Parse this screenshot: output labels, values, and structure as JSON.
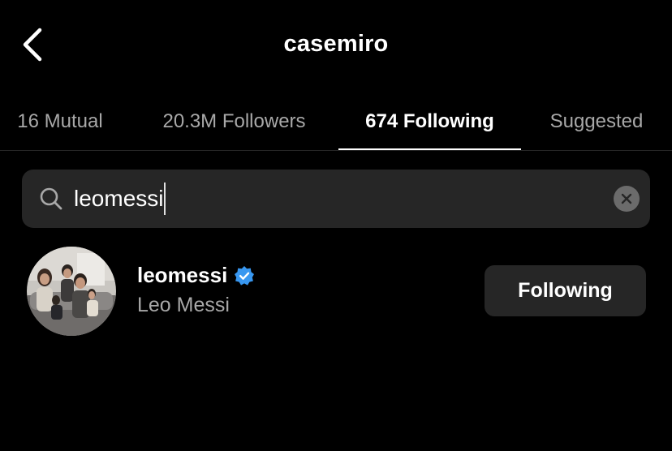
{
  "header": {
    "title": "casemiro",
    "back_icon": "chevron-left-icon"
  },
  "tabs": [
    {
      "label": "16 Mutual",
      "active": false
    },
    {
      "label": "20.3M Followers",
      "active": false
    },
    {
      "label": "674 Following",
      "active": true
    },
    {
      "label": "Suggested",
      "active": false
    }
  ],
  "search": {
    "value": "leomessi",
    "icon": "search-icon",
    "clear_icon": "clear-icon"
  },
  "results": [
    {
      "username": "leomessi",
      "verified": true,
      "full_name": "Leo Messi",
      "button_label": "Following"
    }
  ],
  "colors": {
    "background": "#000000",
    "primary_text": "#ffffff",
    "secondary_text": "#a8a8a8",
    "surface": "#262626",
    "verified_blue": "#3897f0"
  }
}
